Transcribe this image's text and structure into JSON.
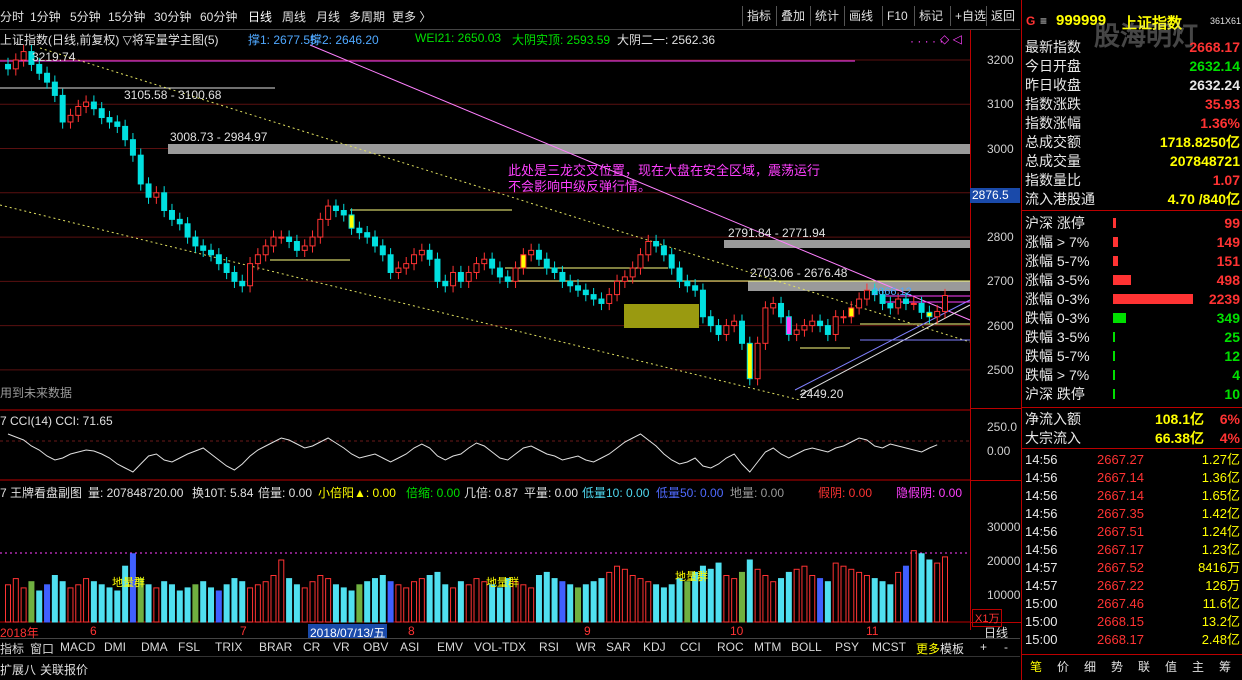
{
  "periods": [
    "分时",
    "1分钟",
    "5分钟",
    "15分钟",
    "30分钟",
    "60分钟",
    "日线",
    "周线",
    "月线",
    "多周期",
    "更多 〉"
  ],
  "toolbar": [
    "指标",
    "叠加",
    "统计",
    "画线",
    "F10",
    "标记",
    "+自选",
    "返回"
  ],
  "legend": {
    "title": "上证指数(日线,前复权) ▽将军量学主图(5)",
    "s1": "撑1: 2677.55",
    "s2": "撑2: 2646.20",
    "wei": "WEI21: 2650.03",
    "yin": "大阴实顶: 2593.59",
    "yin2": "大阴二一: 2562.36"
  },
  "annotations": {
    "p1": "3219.74",
    "p2": "3105.58 - 3100.68",
    "p3": "3008.73 - 2984.97",
    "p4": "2791.84 - 2771.94",
    "p5": "2703.06 - 2676.48",
    "p6": "2449.20",
    "note1": "此处是三龙交叉位置，现在大盘在安全区域，震荡运行",
    "note2": "不会影响中级反弹行情。",
    "future": "用到未来数据",
    "curval": "2876.5",
    "ghost": "2666.12"
  },
  "axis_main": [
    "3200",
    "3100",
    "3000",
    "2900",
    "2800",
    "2700",
    "2600",
    "2500"
  ],
  "cci": {
    "legend": "7 CCI(14)  CCI: 71.65",
    "ticks": [
      "250.0",
      "0.00"
    ]
  },
  "vol": {
    "label": "7 王牌看盘副图",
    "amount": "量: 207848720.00",
    "turnover": "换10T: 5.84",
    "bei": "倍量: 0.00",
    "xiao": "小倍阳▲: 0.00",
    "suo": "倍缩: 0.00",
    "ji": "几倍: 0.87",
    "ping": "平量: 0.00",
    "di10": "低量10: 0.00",
    "di50": "低量50: 0.00",
    "di": "地量: 0.00",
    "jia": "假阴: 0.00",
    "yinj": "隐假阴: 0.00",
    "ticks": [
      "30000",
      "20000",
      "10000"
    ],
    "unit": "X1万",
    "dlq": "地量群"
  },
  "xaxis": {
    "y2018": "2018年",
    "m6": "6",
    "m7": "7",
    "sel": "2018/07/13/五",
    "m8": "8",
    "m9": "9",
    "m10": "10",
    "m11": "11",
    "period": "日线"
  },
  "indicators": [
    "指标",
    "窗口",
    "MACD",
    "DMI",
    "DMA",
    "FSL",
    "TRIX",
    "BRAR",
    "CR",
    "VR",
    "OBV",
    "ASI",
    "EMV",
    "VOL-TDX",
    "RSI",
    "WR",
    "SAR",
    "KDJ",
    "CCI",
    "ROC",
    "MTM",
    "BOLL",
    "PSY",
    "MCST",
    "更多"
  ],
  "bottom_tabs": {
    "t1": "扩展八",
    "t2": "关联报价",
    "mb": "模板",
    "plus": "+",
    "minus": "-"
  },
  "right": {
    "header_g": "G",
    "code": "999999",
    "name": "上证指数",
    "watermark": "股海明灯",
    "tag": "361X61",
    "quote": [
      {
        "label": "最新指数",
        "value": "2668.17",
        "color": "#ff3333"
      },
      {
        "label": "今日开盘",
        "value": "2632.14",
        "color": "#00e000"
      },
      {
        "label": "昨日收盘",
        "value": "2632.24",
        "color": "#e8e8e8"
      },
      {
        "label": "指数涨跌",
        "value": "35.93",
        "color": "#ff3333"
      },
      {
        "label": "指数涨幅",
        "value": "1.36%",
        "color": "#ff3333"
      },
      {
        "label": "总成交额",
        "value": "1718.8250亿",
        "color": "#ffff00"
      },
      {
        "label": "总成交量",
        "value": "207848721",
        "color": "#ffff00"
      },
      {
        "label": "指数量比",
        "value": "1.07",
        "color": "#ff3333"
      },
      {
        "label": "流入港股通",
        "value": "4.70 /840亿",
        "color": "#ffff00"
      }
    ],
    "breadth": [
      {
        "label": "沪深 涨停",
        "value": "99",
        "color": "#ff3333",
        "frac": 0.04
      },
      {
        "label": "涨幅 > 7%",
        "value": "149",
        "color": "#ff3333",
        "frac": 0.06
      },
      {
        "label": "涨幅 5-7%",
        "value": "151",
        "color": "#ff3333",
        "frac": 0.06
      },
      {
        "label": "涨幅 3-5%",
        "value": "498",
        "color": "#ff3333",
        "frac": 0.22
      },
      {
        "label": "涨幅 0-3%",
        "value": "2239",
        "color": "#ff3333",
        "frac": 1.0
      },
      {
        "label": "跌幅 0-3%",
        "value": "349",
        "color": "#00e000",
        "frac": 0.16
      },
      {
        "label": "跌幅 3-5%",
        "value": "25",
        "color": "#00e000",
        "frac": 0.02
      },
      {
        "label": "跌幅 5-7%",
        "value": "12",
        "color": "#00e000",
        "frac": 0.01
      },
      {
        "label": "跌幅 > 7%",
        "value": "4",
        "color": "#00e000",
        "frac": 0.01
      },
      {
        "label": "沪深 跌停",
        "value": "10",
        "color": "#00e000",
        "frac": 0.01
      }
    ],
    "flow": [
      {
        "label": "净流入额",
        "value": "108.1亿",
        "pct": "6%"
      },
      {
        "label": "大宗流入",
        "value": "66.38亿",
        "pct": "4%"
      }
    ],
    "ticks": [
      {
        "t": "14:56",
        "p": "2667.27",
        "v": "1.27亿"
      },
      {
        "t": "14:56",
        "p": "2667.14",
        "v": "1.36亿"
      },
      {
        "t": "14:56",
        "p": "2667.14",
        "v": "1.65亿"
      },
      {
        "t": "14:56",
        "p": "2667.35",
        "v": "1.42亿"
      },
      {
        "t": "14:56",
        "p": "2667.51",
        "v": "1.24亿"
      },
      {
        "t": "14:56",
        "p": "2667.17",
        "v": "1.23亿"
      },
      {
        "t": "14:57",
        "p": "2667.52",
        "v": "8416万"
      },
      {
        "t": "14:57",
        "p": "2667.22",
        "v": "126万"
      },
      {
        "t": "15:00",
        "p": "2667.46",
        "v": "11.6亿"
      },
      {
        "t": "15:00",
        "p": "2668.15",
        "v": "13.2亿"
      },
      {
        "t": "15:00",
        "p": "2668.17",
        "v": "2.48亿"
      }
    ],
    "tabs": [
      "笔",
      "价",
      "细",
      "势",
      "联",
      "值",
      "主",
      "筹"
    ]
  },
  "chart_data": {
    "type": "candlestick",
    "ylim": [
      2420,
      3260
    ],
    "closes": [
      3180,
      3200,
      3219,
      3190,
      3170,
      3150,
      3120,
      3060,
      3075,
      3095,
      3105,
      3090,
      3070,
      3060,
      3050,
      3020,
      2985,
      2920,
      2890,
      2900,
      2860,
      2840,
      2830,
      2800,
      2780,
      2770,
      2760,
      2740,
      2720,
      2700,
      2690,
      2740,
      2760,
      2780,
      2800,
      2800,
      2790,
      2770,
      2780,
      2800,
      2840,
      2870,
      2860,
      2850,
      2820,
      2810,
      2800,
      2780,
      2760,
      2720,
      2730,
      2740,
      2760,
      2770,
      2750,
      2700,
      2690,
      2720,
      2700,
      2720,
      2740,
      2750,
      2730,
      2710,
      2700,
      2730,
      2760,
      2770,
      2750,
      2730,
      2720,
      2700,
      2690,
      2680,
      2670,
      2660,
      2650,
      2670,
      2700,
      2710,
      2730,
      2760,
      2790,
      2780,
      2760,
      2730,
      2700,
      2690,
      2680,
      2620,
      2600,
      2580,
      2600,
      2610,
      2560,
      2480,
      2560,
      2640,
      2650,
      2620,
      2580,
      2590,
      2600,
      2610,
      2600,
      2580,
      2620,
      2620,
      2640,
      2660,
      2680,
      2670,
      2650,
      2640,
      2660,
      2650,
      2650,
      2630,
      2620,
      2632,
      2668
    ],
    "cci": [
      180,
      150,
      120,
      60,
      20,
      -40,
      -80,
      -60,
      -20,
      0,
      20,
      10,
      -20,
      -60,
      -120,
      -160,
      -200,
      -120,
      -40,
      -20,
      -80,
      -100,
      -60,
      -20,
      10,
      40,
      -20,
      -80,
      -140,
      -180,
      -120,
      -40,
      20,
      60,
      100,
      140,
      120,
      80,
      40,
      60,
      100,
      140,
      90,
      40,
      -20,
      -60,
      -40,
      -20,
      -60,
      -100,
      -60,
      -20,
      40,
      80,
      40,
      -40,
      -80,
      -40,
      -20,
      40,
      90,
      60,
      0,
      -60,
      -80,
      -20,
      40,
      60,
      20,
      -20,
      -40,
      -80,
      -60,
      -40,
      -80,
      -100,
      -60,
      -20,
      40,
      100,
      140,
      180,
      120,
      60,
      -20,
      -80,
      -120,
      -100,
      -60,
      -140,
      -160,
      -120,
      -60,
      -20,
      -120,
      -200,
      -100,
      0,
      40,
      -20,
      -60,
      -20,
      20,
      40,
      20,
      0,
      40,
      60,
      100,
      140,
      120,
      60,
      40,
      80,
      60,
      40,
      20,
      0,
      40,
      72
    ],
    "volume": [
      12,
      14,
      11,
      13,
      10,
      12,
      15,
      13,
      11,
      12,
      14,
      13,
      12,
      11,
      10,
      18,
      22,
      14,
      12,
      11,
      13,
      12,
      10,
      11,
      12,
      13,
      11,
      10,
      12,
      14,
      13,
      11,
      12,
      13,
      15,
      20,
      14,
      12,
      11,
      13,
      15,
      14,
      12,
      11,
      10,
      12,
      13,
      14,
      15,
      13,
      12,
      11,
      13,
      14,
      15,
      16,
      12,
      11,
      13,
      12,
      14,
      13,
      12,
      11,
      14,
      13,
      12,
      11,
      15,
      16,
      14,
      13,
      12,
      11,
      12,
      13,
      14,
      16,
      18,
      17,
      15,
      14,
      13,
      12,
      11,
      12,
      14,
      13,
      16,
      18,
      17,
      19,
      15,
      14,
      16,
      20,
      17,
      15,
      13,
      14,
      16,
      17,
      18,
      15,
      14,
      13,
      19,
      18,
      17,
      16,
      15,
      14,
      13,
      12,
      16,
      18,
      23,
      22,
      20,
      19,
      21
    ]
  }
}
